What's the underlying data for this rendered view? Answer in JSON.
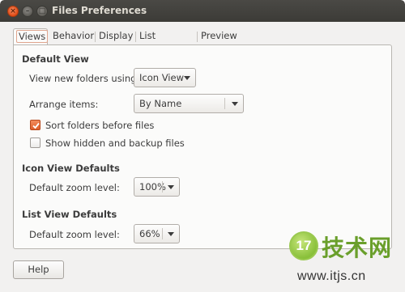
{
  "window": {
    "title": "Files Preferences"
  },
  "tabs": [
    {
      "label": "Views",
      "active": true
    },
    {
      "label": "Behavior",
      "active": false
    },
    {
      "label": "Display",
      "active": false
    },
    {
      "label": "List Columns",
      "active": false
    },
    {
      "label": "Preview",
      "active": false
    }
  ],
  "default_view": {
    "heading": "Default View",
    "view_new_folders_label": "View new folders using:",
    "view_new_folders_value": "Icon View",
    "arrange_items_label": "Arrange items:",
    "arrange_items_value": "By Name",
    "sort_folders_label": "Sort folders before files",
    "sort_folders_checked": true,
    "show_hidden_label": "Show hidden and backup files",
    "show_hidden_checked": false
  },
  "icon_view": {
    "heading": "Icon View Defaults",
    "zoom_label": "Default zoom level:",
    "zoom_value": "100%"
  },
  "list_view": {
    "heading": "List View Defaults",
    "zoom_label": "Default zoom level:",
    "zoom_value": "66%"
  },
  "footer": {
    "help_label": "Help"
  },
  "watermark": {
    "logo_text": "17",
    "brand": "技术网",
    "url": "www.itjs.cn"
  },
  "colors": {
    "accent": "#df5f2b",
    "titlebar": "#3c3b37",
    "close_button": "#df4a16"
  }
}
